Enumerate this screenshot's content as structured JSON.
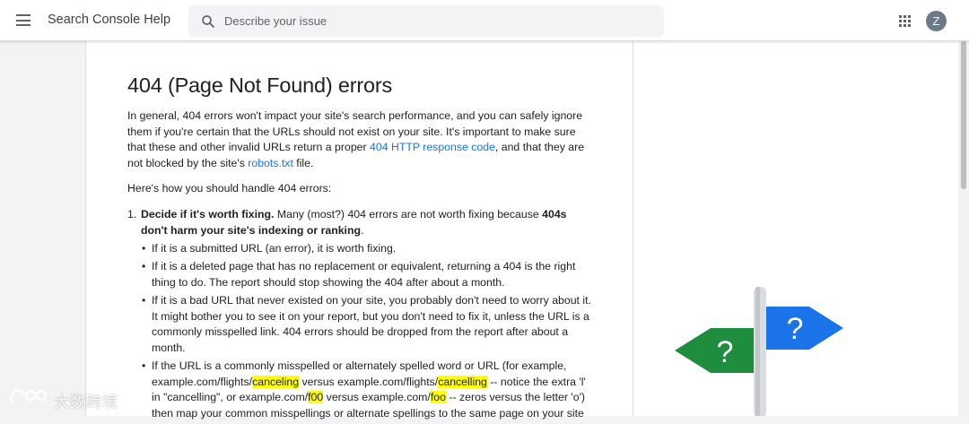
{
  "header": {
    "product_title": "Search Console Help",
    "search_placeholder": "Describe your issue",
    "avatar_letter": "Z"
  },
  "article": {
    "title": "404 (Page Not Found) errors",
    "intro_1": "In general, 404 errors won't impact your site's search performance, and you can safely ignore them if you're certain that the URLs should not exist on your site. It's important to make sure that these and other invalid URLs return a proper ",
    "intro_link_1": "404 HTTP response code",
    "intro_2": ", and that they are not blocked by the site's ",
    "intro_link_2": "robots.txt",
    "intro_3": " file.",
    "howto": "Here's how you should handle 404 errors:",
    "step1_num": "1.",
    "step1_bold": "Decide if it's worth fixing.",
    "step1_text": " Many (most?) 404 errors are not worth fixing because ",
    "step1_bold2": "404s don't harm your site's indexing or ranking",
    "step1_end": ".",
    "bullet1": "If it is a submitted URL (an error), it is worth fixing.",
    "bullet2": "If it is a deleted page that has no replacement or equivalent, returning a 404 is the right thing to do. The report should stop showing the 404 after about a month.",
    "bullet3": "If it is a bad URL that never existed on your site, you probably don't need to worry about it. It might bother you to see it on your report, but you don't need to fix it, unless the URL is a commonly misspelled link. 404 errors should be dropped from the report after about a month.",
    "bullet4_a": "If the URL is a commonly misspelled or alternately spelled word or URL (for example, example.com/flights/",
    "bullet4_hl1": "canceling",
    "bullet4_b": " versus example.com/flights/",
    "bullet4_hl2": "cancelling",
    "bullet4_c": " -- notice the extra 'l' in \"cancelling\", or example.com/",
    "bullet4_hl3": "f00",
    "bullet4_d": " versus example.com/",
    "bullet4_hl4": "foo",
    "bullet4_e": " -- zeros versus the letter 'o') then map your common misspellings or alternate spellings to the same page on your site"
  },
  "illustration": {
    "left_sign_text": "?",
    "right_sign_text": "?",
    "left_sign_color": "#1e8e3e",
    "right_sign_color": "#1a73e8"
  },
  "watermark": {
    "text": "大数跨境"
  },
  "colors": {
    "link": "#1a73e8",
    "highlight": "#ffff00"
  }
}
